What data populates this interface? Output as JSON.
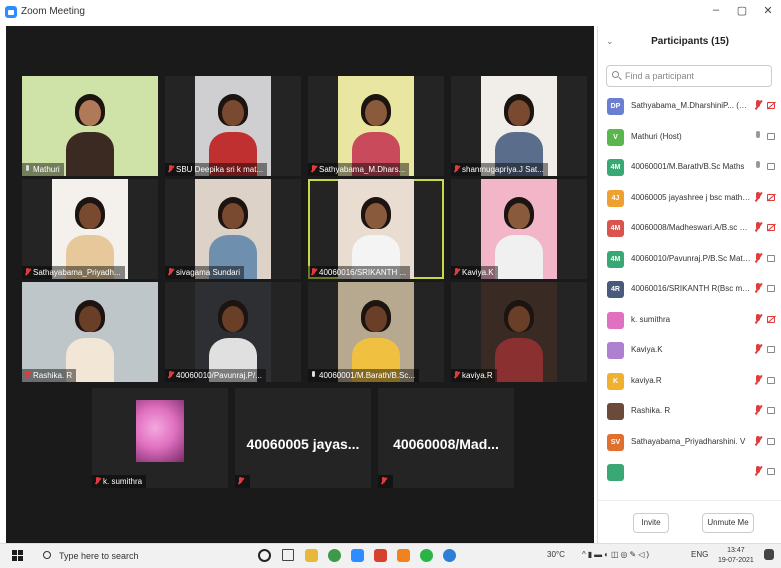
{
  "window": {
    "title": "Zoom Meeting",
    "minimize": "–",
    "maximize": "▢",
    "close": "✕"
  },
  "tiles": [
    {
      "name": "Mathuri",
      "muted": false,
      "bg": "#cfe3a8",
      "skin": "#b07a58",
      "shirt": "#3a2a22"
    },
    {
      "name": "SBU Deepika sri k mat...",
      "muted": true,
      "bg": "#cfcfd2",
      "skin": "#7a4a30",
      "shirt": "#c03030"
    },
    {
      "name": "Sathyabama_M.Dhars...",
      "muted": true,
      "bg": "#e9e6a2",
      "skin": "#8a5a3c",
      "shirt": "#c94a5a"
    },
    {
      "name": "shanmugapriya.J Sat...",
      "muted": true,
      "bg": "#f1eeea",
      "skin": "#7a4a30",
      "shirt": "#5a6d8a"
    },
    {
      "name": "Sathayabama_Priyadh...",
      "muted": true,
      "bg": "#f4f1ec",
      "skin": "#7a4a30",
      "shirt": "#e6c89a"
    },
    {
      "name": "sivagama Sundari",
      "muted": true,
      "bg": "#dcd2c8",
      "skin": "#7a4a30",
      "shirt": "#6f8fae"
    },
    {
      "name": "40060016/SRIKANTH ...",
      "muted": true,
      "bg": "#e8ddd0",
      "skin": "#8a5a3c",
      "shirt": "#f4f4f4",
      "active": true
    },
    {
      "name": "Kaviya.K",
      "muted": true,
      "bg": "#f2b6c8",
      "skin": "#8a5a3c",
      "shirt": "#f0f0f0"
    },
    {
      "name": "Rashika. R",
      "muted": true,
      "bg": "#bfc6c9",
      "skin": "#6a3f28",
      "shirt": "#f2e6d6"
    },
    {
      "name": "40060010/Pavunraj.P/...",
      "muted": true,
      "bg": "#2e2f33",
      "skin": "#6a3f28",
      "shirt": "#e0e0e0"
    },
    {
      "name": "40060001/M.Barath/B.Sc...",
      "muted": false,
      "bg": "#b7a990",
      "skin": "#6a3f28",
      "shirt": "#f0c040"
    },
    {
      "name": "kaviya.R",
      "muted": true,
      "bg": "#3a2a24",
      "skin": "#6a3f28",
      "shirt": "#8a3030"
    }
  ],
  "bottom_tiles": [
    {
      "name": "k. sumithra",
      "muted": true,
      "type": "image",
      "bg": "#e070c0"
    },
    {
      "big": "40060005 jayas...",
      "muted": true,
      "type": "text"
    },
    {
      "big": "40060008/Mad...",
      "muted": true,
      "type": "text"
    }
  ],
  "sidebar": {
    "title": "Participants (15)",
    "search_placeholder": "Find a participant",
    "participants": [
      {
        "initials": "DP",
        "name": "Sathyabama_M.DharshiniP... (Me)",
        "color": "#6b7fd0",
        "mic": "off",
        "cam": "off"
      },
      {
        "initials": "V",
        "name": "Mathuri (Host)",
        "color": "#5bb64f",
        "mic": "on",
        "cam": "on"
      },
      {
        "initials": "4M",
        "name": "40060001/M.Barath/B.Sc Maths",
        "color": "#3aa874",
        "mic": "on",
        "cam": "on"
      },
      {
        "initials": "4J",
        "name": "40060005 jayashree j bsc mathe...",
        "color": "#f0a030",
        "mic": "off",
        "cam": "off"
      },
      {
        "initials": "4M",
        "name": "40060008/Madheswari.A/B.sc m...",
        "color": "#d9534f",
        "mic": "off",
        "cam": "off"
      },
      {
        "initials": "4M",
        "name": "40060010/Pavunraj.P/B.Sc Maths",
        "color": "#3aa874",
        "mic": "off",
        "cam": "on"
      },
      {
        "initials": "4R",
        "name": "40060016/SRIKANTH R(Bsc mat...",
        "color": "#4a5a7a",
        "mic": "off",
        "cam": "on"
      },
      {
        "initials": "",
        "name": "k. sumithra",
        "color": "#e070c0",
        "mic": "off",
        "cam": "off"
      },
      {
        "initials": "",
        "name": "Kaviya.K",
        "color": "#b080d0",
        "mic": "off",
        "cam": "on"
      },
      {
        "initials": "K",
        "name": "kaviya.R",
        "color": "#f0b030",
        "mic": "off",
        "cam": "on"
      },
      {
        "initials": "",
        "name": "Rashika. R",
        "color": "#6a4a3a",
        "mic": "off",
        "cam": "on"
      },
      {
        "initials": "SV",
        "name": "Sathayabama_Priyadharshini. V",
        "color": "#e07030",
        "mic": "off",
        "cam": "on"
      },
      {
        "initials": "",
        "name": "",
        "color": "#3aa874",
        "mic": "off",
        "cam": "on"
      }
    ],
    "invite_label": "Invite",
    "unmute_label": "Unmute Me"
  },
  "taskbar": {
    "search_placeholder": "Type here to search",
    "temperature": "30°C",
    "language": "ENG",
    "time": "13:47",
    "date": "19-07-2021"
  }
}
